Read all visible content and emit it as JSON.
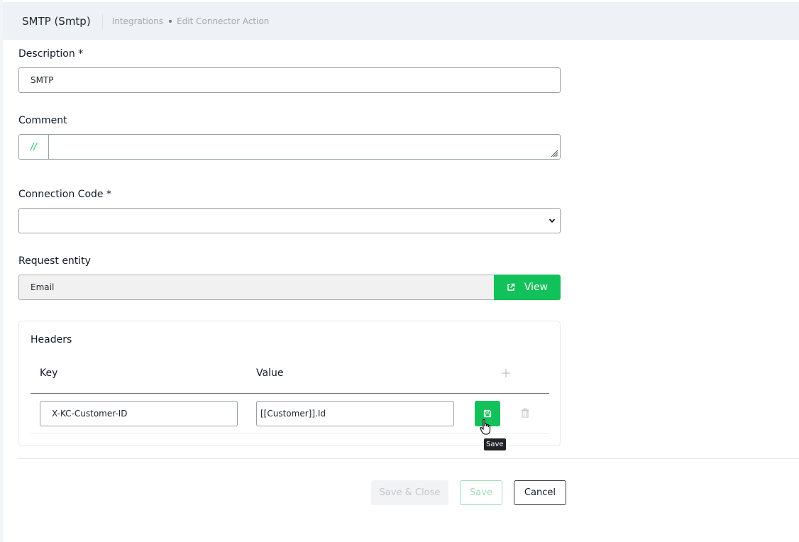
{
  "header": {
    "title": "SMTP (Smtp)",
    "breadcrumb": [
      "Integrations",
      "Edit Connector Action"
    ]
  },
  "form": {
    "description": {
      "label": "Description *",
      "value": "SMTP"
    },
    "comment": {
      "label": "Comment",
      "prefix": "//",
      "value": ""
    },
    "connection_code": {
      "label": "Connection Code *",
      "value": ""
    },
    "request_entity": {
      "label": "Request entity",
      "value": "Email",
      "view_label": "View"
    }
  },
  "headers": {
    "title": "Headers",
    "columns": {
      "key": "Key",
      "value": "Value"
    },
    "rows": [
      {
        "key": "X-KC-Customer-ID",
        "value": "[[Customer]].Id"
      }
    ],
    "tooltip": "Save"
  },
  "footer": {
    "save_close": "Save & Close",
    "save": "Save",
    "cancel": "Cancel"
  },
  "colors": {
    "accent": "#12c15a",
    "header_bg": "#eef1f5"
  },
  "icons": [
    "external-link-icon",
    "plus-icon",
    "floppy-disk-icon",
    "trash-icon",
    "chevron-down-icon",
    "hand-cursor-icon",
    "resize-grip-icon"
  ]
}
